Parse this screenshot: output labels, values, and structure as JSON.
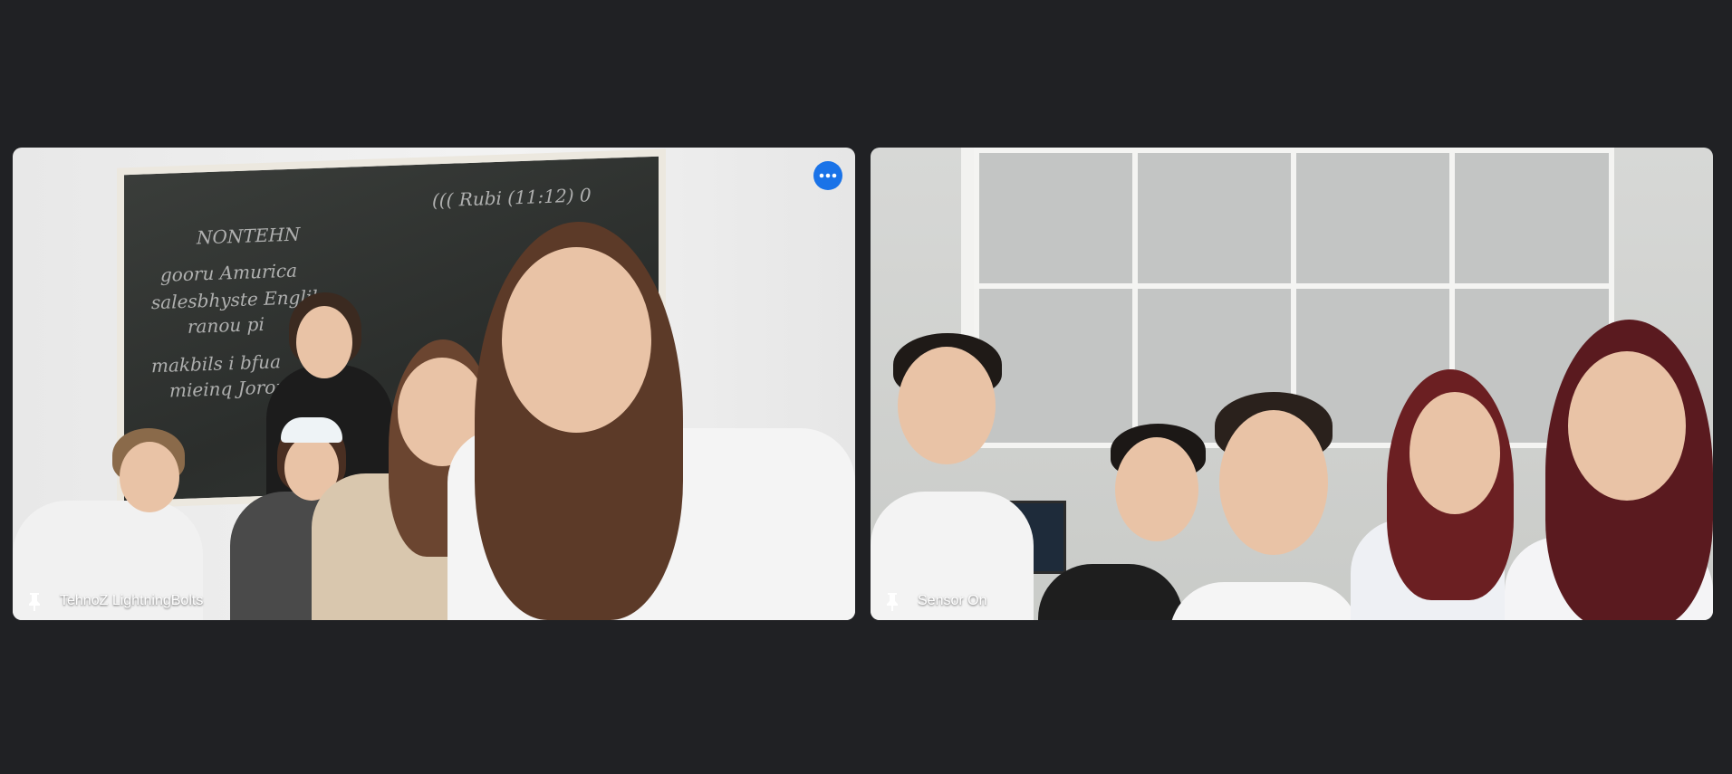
{
  "participants": [
    {
      "name": "TehnoZ LightningBolts",
      "pin_icon": "pin-icon",
      "more_icon": "more-options-icon",
      "more_visible": true
    },
    {
      "name": "Sensor On",
      "pin_icon": "pin-icon",
      "more_visible": false
    }
  ],
  "chalkboard": {
    "lines": [
      "NONTEHN",
      "((( Rubi (11:12) 0",
      "gooru Amurica",
      "salesbhyste Englik",
      "ranou pi",
      "makbils i bfua",
      "mieinq Jorora"
    ]
  },
  "colors": {
    "background": "#202124",
    "accent": "#1a73e8",
    "label_text": "#ffffff"
  }
}
